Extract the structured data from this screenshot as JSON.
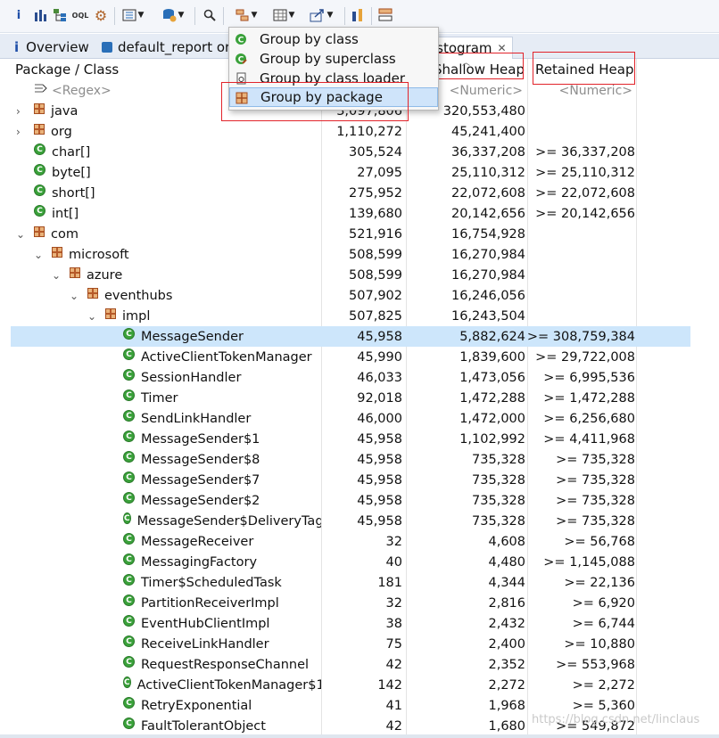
{
  "toolbar": {
    "buttons": [
      "info-icon",
      "histogram-icon",
      "dominator-tree-icon",
      "oql-icon",
      "thread-overview-icon",
      "run-report-icon",
      "query-browser-icon",
      "search-icon",
      "group-by-icon",
      "calculate-icon",
      "export-icon",
      "compare-icon",
      "select-columns-icon"
    ]
  },
  "tabs": {
    "overview": "Overview",
    "report": "default_report  or",
    "histogram": "istogram"
  },
  "menu": {
    "items": [
      {
        "label": "Group by class",
        "icon": "class-icon"
      },
      {
        "label": "Group by superclass",
        "icon": "superclass-icon"
      },
      {
        "label": "Group by class loader",
        "icon": "class-loader-icon"
      },
      {
        "label": "Group by package",
        "icon": "package-icon"
      }
    ]
  },
  "columns": {
    "name": "Package / Class",
    "objects": "",
    "shallow": "Shallow Heap",
    "retained": "Retained Heap"
  },
  "filters": {
    "name": "<Regex>",
    "objects": "",
    "shallow": "<Numeric>",
    "retained": "<Numeric>"
  },
  "rows": [
    {
      "name": "java",
      "objects": "3,097,806",
      "shallow": "320,553,480",
      "retained": ""
    },
    {
      "name": "org",
      "objects": "1,110,272",
      "shallow": "45,241,400",
      "retained": ""
    },
    {
      "name": "char[]",
      "objects": "305,524",
      "shallow": "36,337,208",
      "retained": ">= 36,337,208"
    },
    {
      "name": "byte[]",
      "objects": "27,095",
      "shallow": "25,110,312",
      "retained": ">= 25,110,312"
    },
    {
      "name": "short[]",
      "objects": "275,952",
      "shallow": "22,072,608",
      "retained": ">= 22,072,608"
    },
    {
      "name": "int[]",
      "objects": "139,680",
      "shallow": "20,142,656",
      "retained": ">= 20,142,656"
    },
    {
      "name": "com",
      "objects": "521,916",
      "shallow": "16,754,928",
      "retained": ""
    },
    {
      "name": "microsoft",
      "objects": "508,599",
      "shallow": "16,270,984",
      "retained": ""
    },
    {
      "name": "azure",
      "objects": "508,599",
      "shallow": "16,270,984",
      "retained": ""
    },
    {
      "name": "eventhubs",
      "objects": "507,902",
      "shallow": "16,246,056",
      "retained": ""
    },
    {
      "name": "impl",
      "objects": "507,825",
      "shallow": "16,243,504",
      "retained": ""
    },
    {
      "name": "MessageSender",
      "objects": "45,958",
      "shallow": "5,882,624",
      "retained": ">= 308,759,384"
    },
    {
      "name": "ActiveClientTokenManager",
      "objects": "45,990",
      "shallow": "1,839,600",
      "retained": ">= 29,722,008"
    },
    {
      "name": "SessionHandler",
      "objects": "46,033",
      "shallow": "1,473,056",
      "retained": ">= 6,995,536"
    },
    {
      "name": "Timer",
      "objects": "92,018",
      "shallow": "1,472,288",
      "retained": ">= 1,472,288"
    },
    {
      "name": "SendLinkHandler",
      "objects": "46,000",
      "shallow": "1,472,000",
      "retained": ">= 6,256,680"
    },
    {
      "name": "MessageSender$1",
      "objects": "45,958",
      "shallow": "1,102,992",
      "retained": ">= 4,411,968"
    },
    {
      "name": "MessageSender$8",
      "objects": "45,958",
      "shallow": "735,328",
      "retained": ">= 735,328"
    },
    {
      "name": "MessageSender$7",
      "objects": "45,958",
      "shallow": "735,328",
      "retained": ">= 735,328"
    },
    {
      "name": "MessageSender$2",
      "objects": "45,958",
      "shallow": "735,328",
      "retained": ">= 735,328"
    },
    {
      "name": "MessageSender$DeliveryTag",
      "objects": "45,958",
      "shallow": "735,328",
      "retained": ">= 735,328"
    },
    {
      "name": "MessageReceiver",
      "objects": "32",
      "shallow": "4,608",
      "retained": ">= 56,768"
    },
    {
      "name": "MessagingFactory",
      "objects": "40",
      "shallow": "4,480",
      "retained": ">= 1,145,088"
    },
    {
      "name": "Timer$ScheduledTask",
      "objects": "181",
      "shallow": "4,344",
      "retained": ">= 22,136"
    },
    {
      "name": "PartitionReceiverImpl",
      "objects": "32",
      "shallow": "2,816",
      "retained": ">= 6,920"
    },
    {
      "name": "EventHubClientImpl",
      "objects": "38",
      "shallow": "2,432",
      "retained": ">= 6,744"
    },
    {
      "name": "ReceiveLinkHandler",
      "objects": "75",
      "shallow": "2,400",
      "retained": ">= 10,880"
    },
    {
      "name": "RequestResponseChannel",
      "objects": "42",
      "shallow": "2,352",
      "retained": ">= 553,968"
    },
    {
      "name": "ActiveClientTokenManager$1",
      "objects": "142",
      "shallow": "2,272",
      "retained": ">= 2,272"
    },
    {
      "name": "RetryExponential",
      "objects": "41",
      "shallow": "1,968",
      "retained": ">= 5,360"
    },
    {
      "name": "FaultTolerantObject",
      "objects": "42",
      "shallow": "1,680",
      "retained": ">= 549,872"
    }
  ],
  "watermark": "https://blog.csdn.net/linclaus"
}
